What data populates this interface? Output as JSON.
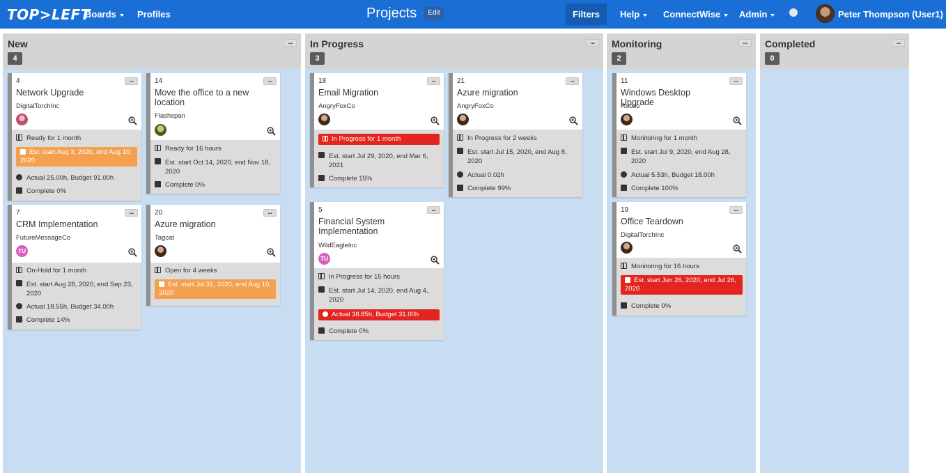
{
  "header": {
    "logo": "TOP>LEFT",
    "nav": {
      "boards": "Boards",
      "profiles": "Profiles",
      "help": "Help",
      "connectwise": "ConnectWise",
      "admin": "Admin"
    },
    "page_title": "Projects",
    "edit_label": "Edit",
    "filters_label": "Filters",
    "user_name": "Peter Thompson (User1)"
  },
  "columns": [
    {
      "title": "New",
      "count": "4"
    },
    {
      "title": "In Progress",
      "count": "3"
    },
    {
      "title": "Monitoring",
      "count": "2"
    },
    {
      "title": "Completed",
      "count": "0"
    }
  ],
  "cards": {
    "c4": {
      "id": "4",
      "title": "Network Upgrade",
      "company": "DigitalTorchInc",
      "status": "Ready for 1 month",
      "est": "Est. start Aug 3, 2020, end Aug 10, 2020",
      "actual": "Actual 25.00h, Budget 91.00h",
      "complete": "Complete 0%"
    },
    "c14": {
      "id": "14",
      "title": "Move the office to a new location",
      "company": "Flashspan",
      "status": "Ready for 16 hours",
      "est": "Est. start Oct 14, 2020, end Nov 18, 2020",
      "complete": "Complete 0%"
    },
    "c7": {
      "id": "7",
      "title": "CRM Implementation",
      "company": "FutureMessageCo",
      "avatar": "TU",
      "status": "On-Hold for 1 month",
      "est": "Est. start Aug 28, 2020, end Sep 23, 2020",
      "actual": "Actual 18.55h, Budget 34.00h",
      "complete": "Complete 14%"
    },
    "c20": {
      "id": "20",
      "title": "Azure migration",
      "company": "Tagcat",
      "status": "Open for 4 weeks",
      "est": "Est. start Jul 31, 2020, end Aug 10, 2020"
    },
    "c18": {
      "id": "18",
      "title": "Email Migration",
      "company": "AngryFoxCo",
      "status": "In Progress for 1 month",
      "est": "Est. start Jul 29, 2020, end Mar 6, 2021",
      "complete": "Complete 15%"
    },
    "c21": {
      "id": "21",
      "title": "Azure migration",
      "company": "AngryFoxCo",
      "status": "In Progress for 2 weeks",
      "est": "Est. start Jul 15, 2020, end Aug 8, 2020",
      "actual": "Actual 0.02h",
      "complete": "Complete 99%"
    },
    "c5": {
      "id": "5",
      "title": "Financial System Implementation",
      "company": "WildEagleInc",
      "avatar": "TU",
      "status": "In Progress for 15 hours",
      "est": "Est. start Jul 14, 2020, end Aug 4, 2020",
      "actual": "Actual 38.85h, Budget 31.00h",
      "complete": "Complete 0%"
    },
    "c11": {
      "id": "11",
      "title": "Windows Desktop Upgrade",
      "company": "Rooxo",
      "status": "Monitoring for 1 month",
      "est": "Est. start Jul 9, 2020, end Aug 28, 2020",
      "actual": "Actual 5.53h, Budget 18.00h",
      "complete": "Complete 100%"
    },
    "c19": {
      "id": "19",
      "title": "Office Teardown",
      "company": "DigitalTorchInc",
      "status": "Monitoring for 16 hours",
      "est": "Est. start Jun 26, 2020, end Jul 26, 2020",
      "complete": "Complete 0%"
    }
  },
  "colors": {
    "topbar": "#1a6fd6",
    "column": "#c9ddf2",
    "column_header": "#d4d4d4",
    "warning": "#f4a04f",
    "danger": "#e4251f"
  }
}
